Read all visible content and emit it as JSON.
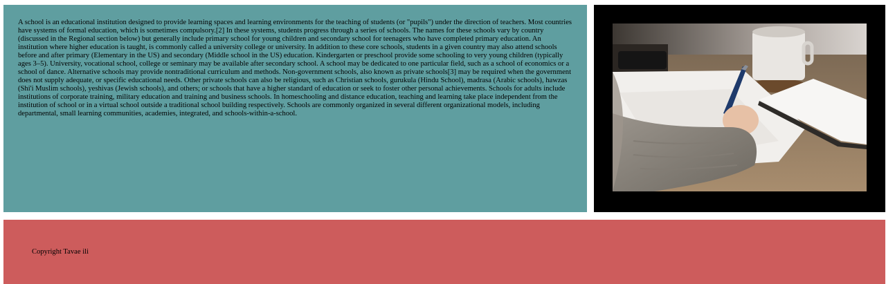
{
  "main": {
    "paragraph": "A school is an educational institution designed to provide learning spaces and learning environments for the teaching of students (or \"pupils\") under the direction of teachers. Most countries have systems of formal education, which is sometimes compulsory.[2] In these systems, students progress through a series of schools. The names for these schools vary by country (discussed in the Regional section below) but generally include primary school for young children and secondary school for teenagers who have completed primary education. An institution where higher education is taught, is commonly called a university college or university. In addition to these core schools, students in a given country may also attend schools before and after primary (Elementary in the US) and secondary (Middle school in the US) education. Kindergarten or preschool provide some schooling to very young children (typically ages 3–5). University, vocational school, college or seminary may be available after secondary school. A school may be dedicated to one particular field, such as a school of economics or a school of dance. Alternative schools may provide nontraditional curriculum and methods. Non-government schools, also known as private schools[3] may be required when the government does not supply adequate, or specific educational needs. Other private schools can also be religious, such as Christian schools, gurukula (Hindu School), madrasa (Arabic schools), hawzas (Shi'i Muslim schools), yeshivas (Jewish schools), and others; or schools that have a higher standard of education or seek to foster other personal achievements. Schools for adults include institutions of corporate training, military education and training and business schools. In homeschooling and distance education, teaching and learning take place independent from the institution of school or in a virtual school outside a traditional school building respectively. Schools are commonly organized in several different organizational models, including departmental, small learning communities, academies, integrated, and schools-within-a-school."
  },
  "image": {
    "icon": "photo-writing-notes"
  },
  "footer": {
    "copyright": "Copyright Tavae ili"
  },
  "colors": {
    "text_panel_bg": "#5f9ea0",
    "image_panel_bg": "#000000",
    "footer_bg": "#cd5c5c"
  }
}
